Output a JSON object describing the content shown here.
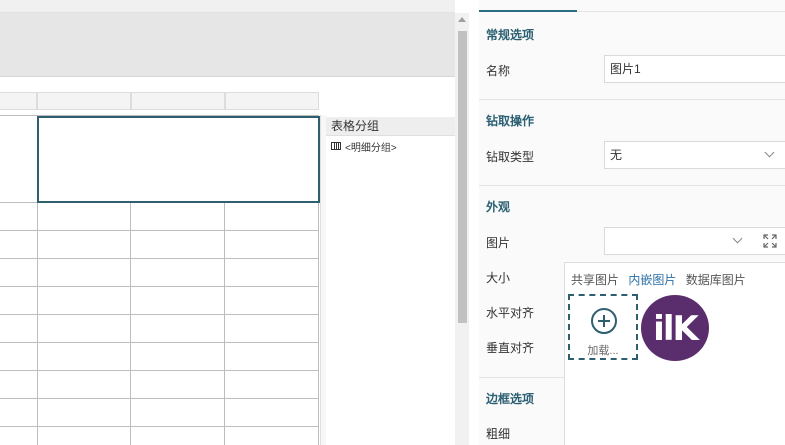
{
  "group_panel": {
    "header": "表格分组",
    "item": "<明细分组>"
  },
  "properties": {
    "general": {
      "title": "常规选项",
      "name_label": "名称",
      "name_value": "图片1"
    },
    "drill": {
      "title": "钻取操作",
      "type_label": "钻取类型",
      "type_value": "无"
    },
    "appearance": {
      "title": "外观",
      "image_label": "图片",
      "image_value": "",
      "size_label": "大小",
      "halign_label": "水平对齐",
      "valign_label": "垂直对齐"
    },
    "border": {
      "title": "边框选项",
      "thickness_label": "粗细"
    }
  },
  "image_picker": {
    "tabs": [
      "共享图片",
      "内嵌图片",
      "数据库图片"
    ],
    "active_tab": "内嵌图片",
    "add_label": "加载...",
    "logo_text": "ilK",
    "logo_color": "#5a2d6d",
    "accent_color": "#2d5f6f"
  }
}
